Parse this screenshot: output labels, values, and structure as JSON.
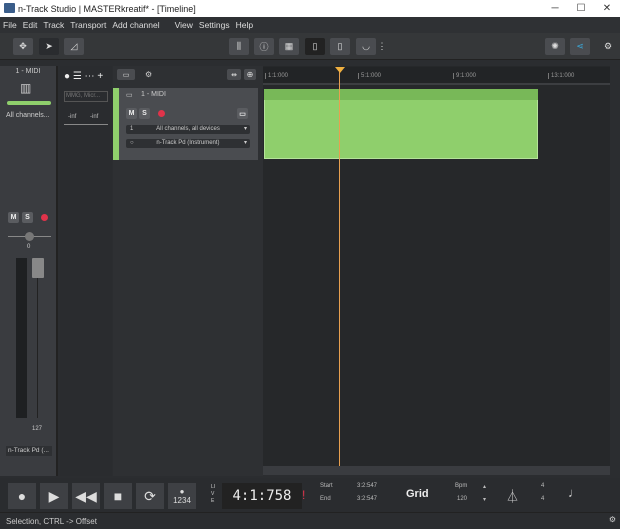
{
  "window": {
    "title": "n-Track Studio | MASTERkreatif* - [Timeline]",
    "minimize": "─",
    "maximize": "☐",
    "close": "✕"
  },
  "menu": [
    "File",
    "Edit",
    "Track",
    "Transport",
    "Add channel",
    "View",
    "Settings",
    "Help"
  ],
  "left": {
    "channel_name": "1 - MIDI",
    "input": "All channels...",
    "mute": "M",
    "solo": "S",
    "pan_value": "0",
    "volume_value": "127",
    "instrument": "n-Track Pd (..."
  },
  "meter": {
    "input_placeholder": "MMG, Micr...",
    "left_peak": "-inf",
    "right_peak": "-inf"
  },
  "track": {
    "name": "1 - MIDI",
    "mute": "M",
    "solo": "S",
    "input": "All channels, all devices",
    "input_index": "1",
    "output": "n-Track Pd (Instrument)",
    "output_index": "○"
  },
  "ruler": [
    "1:1:000",
    "5:1:000",
    "9:1:000",
    "13:1:000"
  ],
  "transport": {
    "time": "4:1:758",
    "live": "LIVE",
    "start_label": "Start",
    "end_label": "End",
    "start_value": "3:2:547",
    "end_value": "3:2:547",
    "grid": "Grid",
    "bpm_label": "Bpm",
    "bpm_value": "120",
    "sig_top": "4",
    "sig_bottom": "4",
    "countin": "1234"
  },
  "status": "Selection, CTRL -> Offset",
  "colors": {
    "clip": "#8fcf6c",
    "playhead": "#f0b040",
    "record": "#e0334a",
    "accent": "#3aa7d8"
  }
}
